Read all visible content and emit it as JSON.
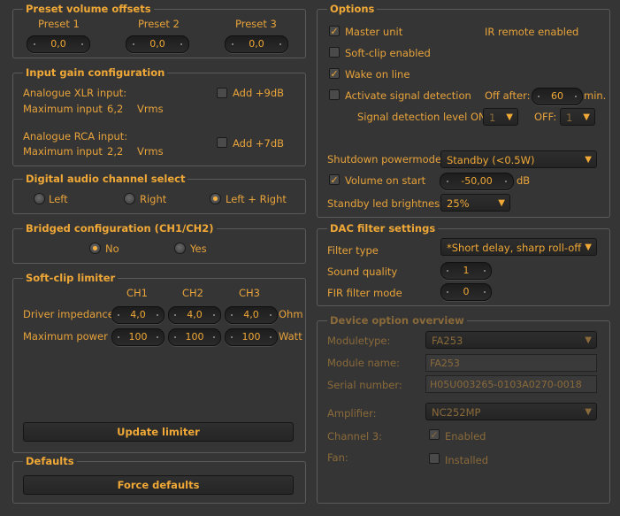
{
  "preset": {
    "title": "Preset volume offsets",
    "labels": [
      "Preset 1",
      "Preset 2",
      "Preset 3"
    ],
    "values": [
      "0,0",
      "0,0",
      "0,0"
    ]
  },
  "input_gain": {
    "title": "Input gain configuration",
    "xlr_label": "Analogue XLR input:",
    "xlr_max_label": "Maximum input",
    "xlr_max_value": "6,2",
    "xlr_unit": "Vrms",
    "xlr_add": "Add +9dB",
    "rca_label": "Analogue RCA input:",
    "rca_max_label": "Maximum input",
    "rca_max_value": "2,2",
    "rca_unit": "Vrms",
    "rca_add": "Add +7dB"
  },
  "digital": {
    "title": "Digital audio channel select",
    "options": [
      "Left",
      "Right",
      "Left + Right"
    ],
    "selected": 2
  },
  "bridged": {
    "title": "Bridged configuration (CH1/CH2)",
    "options": [
      "No",
      "Yes"
    ],
    "selected": 0
  },
  "softclip": {
    "title": "Soft-clip limiter",
    "channels": [
      "CH1",
      "CH2",
      "CH3"
    ],
    "impedance_label": "Driver impedance",
    "impedance_values": [
      "4,0",
      "4,0",
      "4,0"
    ],
    "impedance_unit": "Ohm",
    "power_label": "Maximum power",
    "power_values": [
      "100",
      "100",
      "100"
    ],
    "power_unit": "Watt",
    "update_button": "Update limiter"
  },
  "defaults": {
    "title": "Defaults",
    "force_button": "Force defaults"
  },
  "options": {
    "title": "Options",
    "master_unit": "Master unit",
    "ir_remote": "IR remote enabled",
    "softclip_enabled": "Soft-clip enabled",
    "wake_on_line": "Wake on line",
    "activate_signal": "Activate signal detection",
    "off_after_label": "Off after:",
    "off_after_value": "60",
    "off_after_unit": "min.",
    "level_on_label": "Signal detection level ON:",
    "level_on_value": "1",
    "level_off_label": "OFF:",
    "level_off_value": "1",
    "shutdown_label": "Shutdown powermode:",
    "shutdown_value": "Standby (<0.5W)",
    "volume_start_label": "Volume on start",
    "volume_start_value": "-50,00",
    "volume_start_unit": "dB",
    "standby_led_label": "Standby led brightness",
    "standby_led_value": "25%"
  },
  "dac": {
    "title": "DAC filter settings",
    "filter_type_label": "Filter type",
    "filter_type_value": "*Short delay, sharp roll-off",
    "sound_quality_label": "Sound quality",
    "sound_quality_value": "1",
    "fir_label": "FIR filter mode",
    "fir_value": "0"
  },
  "device": {
    "title": "Device option overview",
    "moduletype_label": "Moduletype:",
    "moduletype_value": "FA253",
    "module_name_label": "Module name:",
    "module_name_value": "FA253",
    "serial_label": "Serial number:",
    "serial_value": "H05U003265-0103A0270-0018",
    "amplifier_label": "Amplifier:",
    "amplifier_value": "NC252MP",
    "channel3_label": "Channel 3:",
    "channel3_value": "Enabled",
    "fan_label": "Fan:",
    "fan_value": "Installed"
  }
}
